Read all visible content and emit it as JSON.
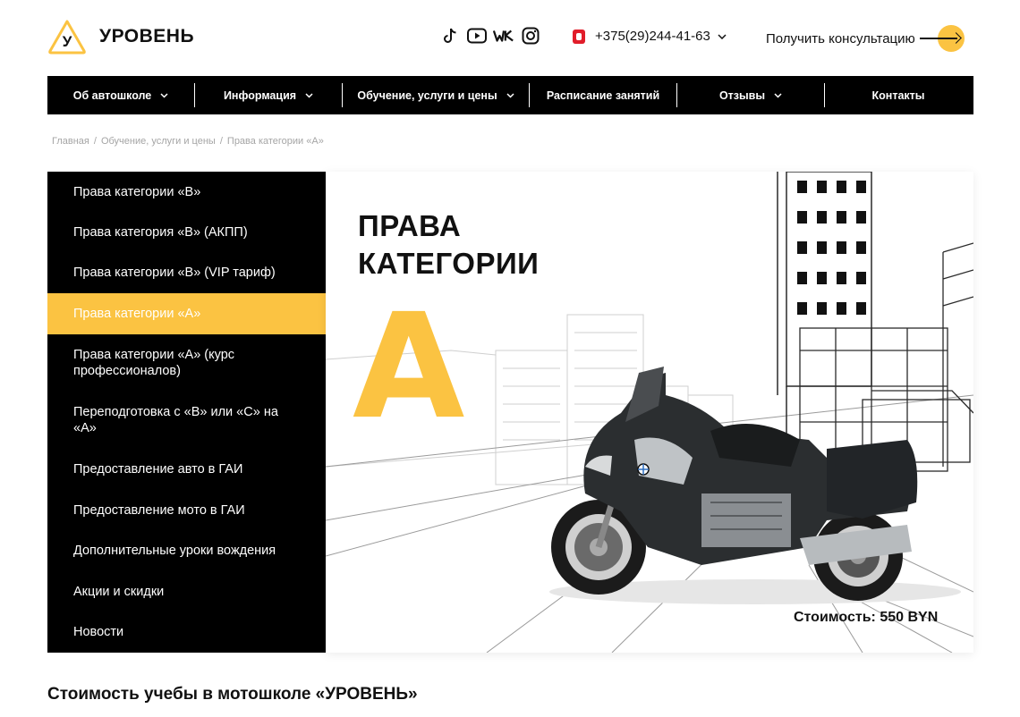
{
  "header": {
    "logo_letter": "У",
    "brand": "УРОВЕНЬ",
    "socials": [
      "tiktok-icon",
      "youtube-icon",
      "vk-icon",
      "instagram-icon"
    ],
    "phone": "+375(29)244-41-63",
    "consult_label": "Получить консультацию"
  },
  "nav": {
    "items": [
      {
        "label": "Об автошколе",
        "has_dropdown": true
      },
      {
        "label": "Информация",
        "has_dropdown": true
      },
      {
        "label": "Обучение, услуги и цены",
        "has_dropdown": true
      },
      {
        "label": "Расписание занятий",
        "has_dropdown": false
      },
      {
        "label": "Отзывы",
        "has_dropdown": true
      },
      {
        "label": "Контакты",
        "has_dropdown": false
      }
    ]
  },
  "breadcrumb": {
    "items": [
      "Главная",
      "Обучение, услуги и цены",
      "Права категории «А»"
    ],
    "separator": "/"
  },
  "sidebar": {
    "items": [
      {
        "label": "Права категории «В»"
      },
      {
        "label": "Права категория «В» (АКПП)"
      },
      {
        "label": "Права категории «В» (VIP тариф)"
      },
      {
        "label": "Права категории «А»",
        "active": true
      },
      {
        "label": "Права категории «А» (курс профессионалов)"
      },
      {
        "label": "Переподготовка с «В» или «С» на «А»"
      },
      {
        "label": "Предоставление авто в ГАИ"
      },
      {
        "label": "Предоставление мото в ГАИ"
      },
      {
        "label": "Дополнительные уроки вождения"
      },
      {
        "label": "Акции и скидки"
      },
      {
        "label": "Новости"
      }
    ]
  },
  "hero": {
    "title_line1": "ПРАВА",
    "title_line2": "КАТЕГОРИИ",
    "letter": "А",
    "price": "Стоимость: 550 BYN"
  },
  "section_title": "Стоимость учебы в мотошколе «УРОВЕНЬ»",
  "colors": {
    "accent": "#fbc342",
    "nav_bg": "#000000",
    "phone_badge": "#e11d2a",
    "breadcrumb": "#a5a5a5"
  }
}
